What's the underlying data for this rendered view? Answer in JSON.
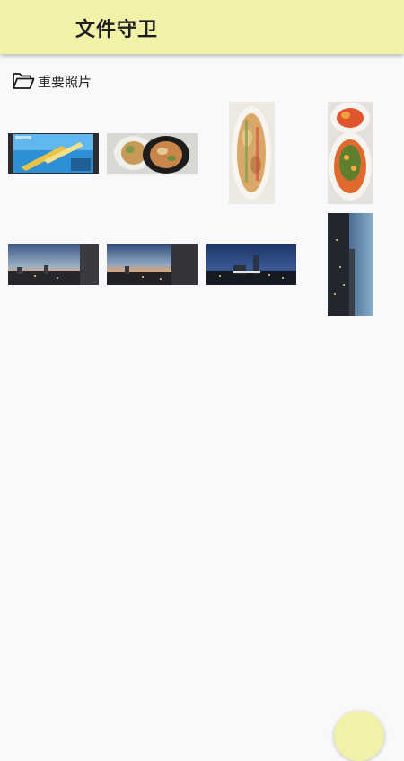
{
  "app_bar": {
    "title": "文件守卫"
  },
  "folder": {
    "icon": "folder-open-icon",
    "label": "重要照片"
  },
  "photos": [
    {
      "name": "photo-game-screen",
      "orientation": "landscape"
    },
    {
      "name": "photo-food-plates",
      "orientation": "landscape"
    },
    {
      "name": "photo-food-dish",
      "orientation": "portrait"
    },
    {
      "name": "photo-food-plates-tall",
      "orientation": "portrait"
    },
    {
      "name": "photo-city-sunset-1",
      "orientation": "landscape"
    },
    {
      "name": "photo-city-sunset-2",
      "orientation": "landscape"
    },
    {
      "name": "photo-city-night",
      "orientation": "landscape"
    },
    {
      "name": "photo-city-coast",
      "orientation": "portrait"
    }
  ],
  "colors": {
    "app_bar": "#f2f1a8",
    "background": "#f9f9fb"
  }
}
